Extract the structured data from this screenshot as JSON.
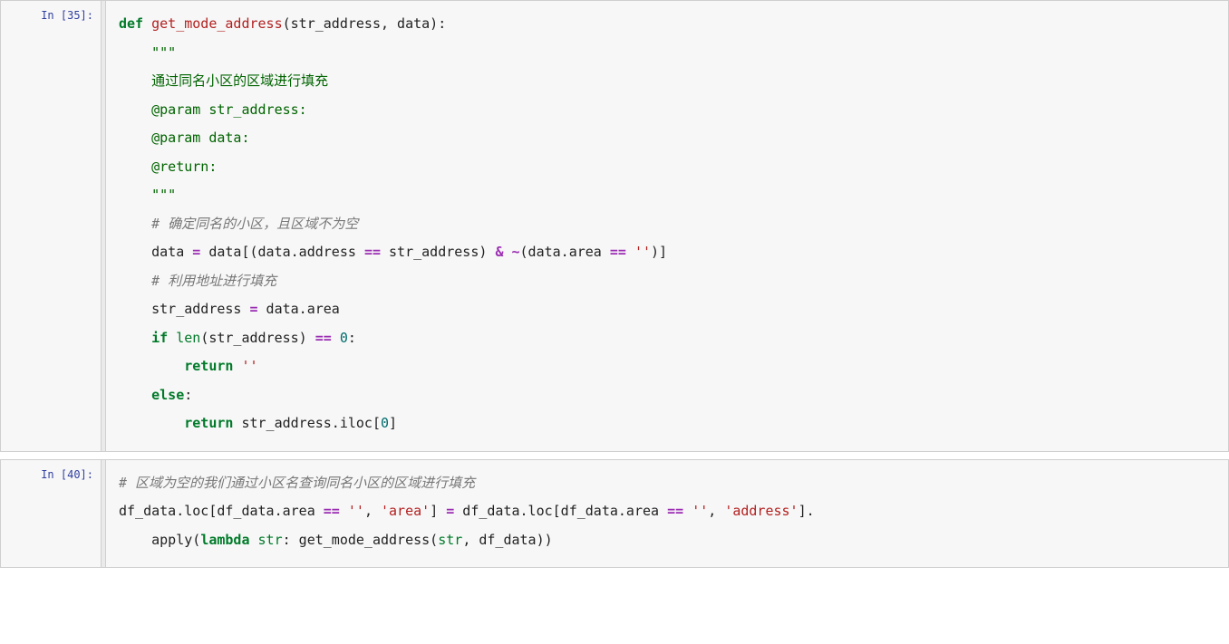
{
  "cells": [
    {
      "prompt": "In [35]:",
      "lines": [
        [
          {
            "cls": "kw",
            "t": "def"
          },
          {
            "cls": "",
            "t": " "
          },
          {
            "cls": "fname",
            "t": "get_mode_address"
          },
          {
            "cls": "",
            "t": "(str_address, data):"
          }
        ],
        [
          {
            "cls": "",
            "t": "    "
          },
          {
            "cls": "docstr",
            "t": "\"\"\""
          }
        ],
        [
          {
            "cls": "",
            "t": "    "
          },
          {
            "cls": "docstr",
            "t": "通过同名小区的区域进行填充"
          }
        ],
        [
          {
            "cls": "",
            "t": "    "
          },
          {
            "cls": "docstr",
            "t": "@param str_address:"
          }
        ],
        [
          {
            "cls": "",
            "t": "    "
          },
          {
            "cls": "docstr",
            "t": "@param data:"
          }
        ],
        [
          {
            "cls": "",
            "t": "    "
          },
          {
            "cls": "docstr",
            "t": "@return:"
          }
        ],
        [
          {
            "cls": "",
            "t": "    "
          },
          {
            "cls": "docstr",
            "t": "\"\"\""
          }
        ],
        [
          {
            "cls": "",
            "t": "    "
          },
          {
            "cls": "comment",
            "t": "# 确定同名的小区，且区域不为空"
          }
        ],
        [
          {
            "cls": "",
            "t": "    data "
          },
          {
            "cls": "op",
            "t": "="
          },
          {
            "cls": "",
            "t": " data[(data.address "
          },
          {
            "cls": "op",
            "t": "=="
          },
          {
            "cls": "",
            "t": " str_address) "
          },
          {
            "cls": "op",
            "t": "&"
          },
          {
            "cls": "",
            "t": " "
          },
          {
            "cls": "op",
            "t": "~"
          },
          {
            "cls": "",
            "t": "(data.area "
          },
          {
            "cls": "op",
            "t": "=="
          },
          {
            "cls": "",
            "t": " "
          },
          {
            "cls": "str",
            "t": "''"
          },
          {
            "cls": "",
            "t": ")]"
          }
        ],
        [
          {
            "cls": "",
            "t": "    "
          },
          {
            "cls": "comment",
            "t": "# 利用地址进行填充"
          }
        ],
        [
          {
            "cls": "",
            "t": "    str_address "
          },
          {
            "cls": "op",
            "t": "="
          },
          {
            "cls": "",
            "t": " data.area"
          }
        ],
        [
          {
            "cls": "",
            "t": "    "
          },
          {
            "cls": "kw",
            "t": "if"
          },
          {
            "cls": "",
            "t": " "
          },
          {
            "cls": "builtin",
            "t": "len"
          },
          {
            "cls": "",
            "t": "(str_address) "
          },
          {
            "cls": "op",
            "t": "=="
          },
          {
            "cls": "",
            "t": " "
          },
          {
            "cls": "num",
            "t": "0"
          },
          {
            "cls": "",
            "t": ":"
          }
        ],
        [
          {
            "cls": "",
            "t": "        "
          },
          {
            "cls": "kw",
            "t": "return"
          },
          {
            "cls": "",
            "t": " "
          },
          {
            "cls": "str",
            "t": "''"
          }
        ],
        [
          {
            "cls": "",
            "t": "    "
          },
          {
            "cls": "kw",
            "t": "else"
          },
          {
            "cls": "",
            "t": ":"
          }
        ],
        [
          {
            "cls": "",
            "t": "        "
          },
          {
            "cls": "kw",
            "t": "return"
          },
          {
            "cls": "",
            "t": " str_address.iloc["
          },
          {
            "cls": "num",
            "t": "0"
          },
          {
            "cls": "",
            "t": "]"
          }
        ]
      ]
    },
    {
      "prompt": "In [40]:",
      "lines": [
        [
          {
            "cls": "comment",
            "t": "# 区域为空的我们通过小区名查询同名小区的区域进行填充"
          }
        ],
        [
          {
            "cls": "",
            "t": "df_data.loc[df_data.area "
          },
          {
            "cls": "op",
            "t": "=="
          },
          {
            "cls": "",
            "t": " "
          },
          {
            "cls": "str",
            "t": "''"
          },
          {
            "cls": "",
            "t": ", "
          },
          {
            "cls": "str",
            "t": "'area'"
          },
          {
            "cls": "",
            "t": "] "
          },
          {
            "cls": "op",
            "t": "="
          },
          {
            "cls": "",
            "t": " df_data.loc[df_data.area "
          },
          {
            "cls": "op",
            "t": "=="
          },
          {
            "cls": "",
            "t": " "
          },
          {
            "cls": "str",
            "t": "''"
          },
          {
            "cls": "",
            "t": ", "
          },
          {
            "cls": "str",
            "t": "'address'"
          },
          {
            "cls": "",
            "t": "]."
          }
        ],
        [
          {
            "cls": "",
            "t": "    apply("
          },
          {
            "cls": "kw",
            "t": "lambda"
          },
          {
            "cls": "",
            "t": " "
          },
          {
            "cls": "builtin",
            "t": "str"
          },
          {
            "cls": "",
            "t": ": get_mode_address("
          },
          {
            "cls": "builtin",
            "t": "str"
          },
          {
            "cls": "",
            "t": ", df_data))"
          }
        ]
      ]
    }
  ]
}
